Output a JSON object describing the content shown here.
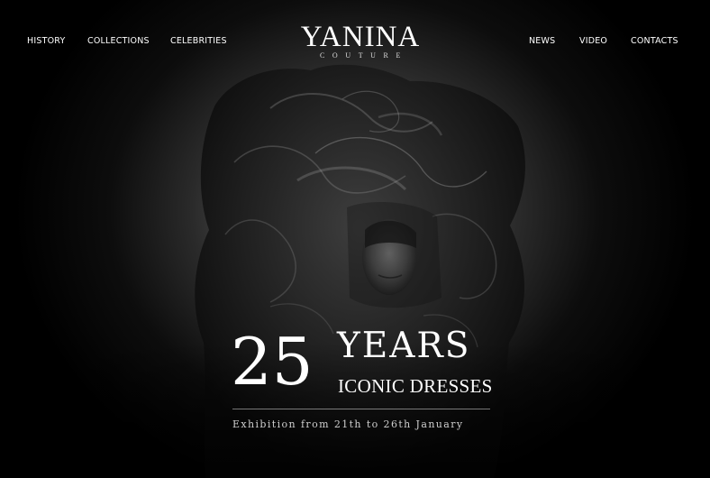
{
  "nav": {
    "left": [
      "HISTORY",
      "COLLECTIONS",
      "CELEBRITIES"
    ],
    "right": [
      "NEWS",
      "VIDEO",
      "CONTACTS"
    ]
  },
  "logo": {
    "name": "YANINA",
    "tagline": "COUTURE"
  },
  "hero": {
    "number": "25",
    "headline": "YEARS",
    "subheadline": "ICONIC DRESSES",
    "exhibition": "Exhibition from 21th to 26th January"
  },
  "colors": {
    "background": "#000000",
    "text": "#ffffff",
    "subtext": "#cfcfcf"
  }
}
